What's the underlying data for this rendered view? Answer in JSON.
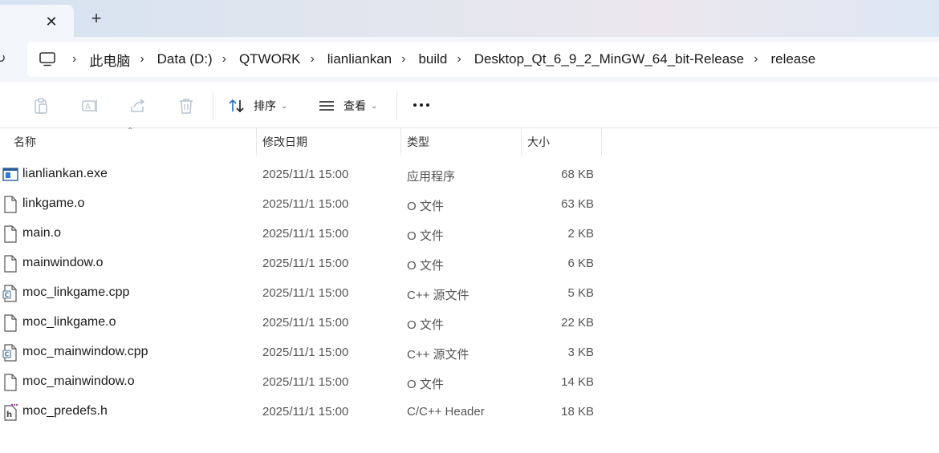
{
  "tabbar": {
    "close_glyph": "✕",
    "new_tab_glyph": "+"
  },
  "address_bar": {
    "separator": "›",
    "breadcrumbs": [
      "此电脑",
      "Data (D:)",
      "QTWORK",
      "lianliankan",
      "build",
      "Desktop_Qt_6_9_2_MinGW_64_bit-Release",
      "release"
    ]
  },
  "commandbar": {
    "sort_label": "排序",
    "view_label": "查看",
    "more_glyph": "•••",
    "dropdown_glyph": "⌄"
  },
  "columns": {
    "name": "名称",
    "date": "修改日期",
    "type": "类型",
    "size": "大小",
    "sort_glyph": "⌃"
  },
  "files": [
    {
      "name": "lianliankan.exe",
      "date": "2025/11/1 15:00",
      "type": "应用程序",
      "size": "68 KB",
      "icon": "exe-icon"
    },
    {
      "name": "linkgame.o",
      "date": "2025/11/1 15:00",
      "type": "O 文件",
      "size": "63 KB",
      "icon": "file-icon"
    },
    {
      "name": "main.o",
      "date": "2025/11/1 15:00",
      "type": "O 文件",
      "size": "2 KB",
      "icon": "file-icon"
    },
    {
      "name": "mainwindow.o",
      "date": "2025/11/1 15:00",
      "type": "O 文件",
      "size": "6 KB",
      "icon": "file-icon"
    },
    {
      "name": "moc_linkgame.cpp",
      "date": "2025/11/1 15:00",
      "type": "C++ 源文件",
      "size": "5 KB",
      "icon": "cpp-file-icon"
    },
    {
      "name": "moc_linkgame.o",
      "date": "2025/11/1 15:00",
      "type": "O 文件",
      "size": "22 KB",
      "icon": "file-icon"
    },
    {
      "name": "moc_mainwindow.cpp",
      "date": "2025/11/1 15:00",
      "type": "C++ 源文件",
      "size": "3 KB",
      "icon": "cpp-file-icon"
    },
    {
      "name": "moc_mainwindow.o",
      "date": "2025/11/1 15:00",
      "type": "O 文件",
      "size": "14 KB",
      "icon": "file-icon"
    },
    {
      "name": "moc_predefs.h",
      "date": "2025/11/1 15:00",
      "type": "C/C++ Header",
      "size": "18 KB",
      "icon": "header-file-icon"
    }
  ],
  "colors": {
    "accent": "#1f6fbf",
    "text": "#1a1a1a",
    "muted_text": "#555555",
    "disabled_icon": "#b8c4d0"
  }
}
